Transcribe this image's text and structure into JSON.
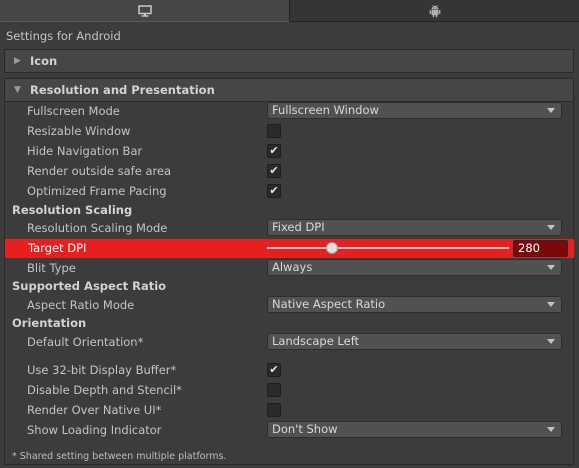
{
  "tabs": [
    {
      "name": "desktop",
      "icon": "monitor-icon"
    },
    {
      "name": "android",
      "icon": "android-icon"
    }
  ],
  "title": "Settings for Android",
  "sections": {
    "icon": {
      "label": "Icon",
      "arrow": "▶"
    },
    "resolution": {
      "label": "Resolution and Presentation",
      "arrow": "▼"
    }
  },
  "fields": {
    "fullscreen_mode": {
      "label": "Fullscreen Mode",
      "value": "Fullscreen Window"
    },
    "resizable_window": {
      "label": "Resizable Window",
      "checked": false
    },
    "hide_navigation_bar": {
      "label": "Hide Navigation Bar",
      "checked": true
    },
    "render_outside_safe_area": {
      "label": "Render outside safe area",
      "checked": true
    },
    "optimized_frame_pacing": {
      "label": "Optimized Frame Pacing",
      "checked": true
    },
    "resolution_scaling_mode": {
      "label": "Resolution Scaling Mode",
      "value": "Fixed DPI"
    },
    "target_dpi": {
      "label": "Target DPI",
      "value": "280",
      "slider_fraction": 0.27
    },
    "blit_type": {
      "label": "Blit Type",
      "value": "Always"
    },
    "aspect_ratio_mode": {
      "label": "Aspect Ratio Mode",
      "value": "Native Aspect Ratio"
    },
    "default_orientation": {
      "label": "Default Orientation*",
      "value": "Landscape Left"
    },
    "use_32bit_display_buffer": {
      "label": "Use 32-bit Display Buffer*",
      "checked": true
    },
    "disable_depth_stencil": {
      "label": "Disable Depth and Stencil*",
      "checked": false
    },
    "render_over_native_ui": {
      "label": "Render Over Native UI*",
      "checked": false
    },
    "show_loading_indicator": {
      "label": "Show Loading Indicator",
      "value": "Don't Show"
    }
  },
  "groups": {
    "resolution_scaling": "Resolution Scaling",
    "supported_aspect_ratio": "Supported Aspect Ratio",
    "orientation": "Orientation"
  },
  "footnote": "* Shared setting between multiple platforms.",
  "colors": {
    "background": "#3c3c3c",
    "highlight": "#e81f1f",
    "text": "#c4c4c4"
  }
}
